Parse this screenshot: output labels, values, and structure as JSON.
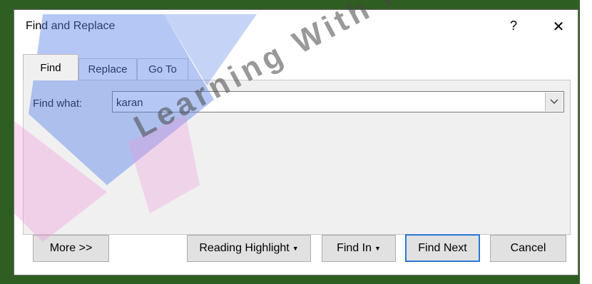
{
  "dialog": {
    "title": "Find and Replace",
    "help_label": "?",
    "close_label": "✕"
  },
  "tabs": [
    {
      "label": "Find",
      "active": true
    },
    {
      "label": "Replace",
      "active": false
    },
    {
      "label": "Go To",
      "active": false
    }
  ],
  "find": {
    "label": "Find what:",
    "value": "karan"
  },
  "buttons": {
    "more": "More >>",
    "reading_highlight": "Reading Highlight",
    "find_in": "Find In",
    "find_next": "Find Next",
    "cancel": "Cancel"
  },
  "watermark": {
    "text": "Learning With Innovation"
  },
  "colors": {
    "accent": "#2a78d4",
    "frame": "#2f5e22",
    "panel": "#f0f0f0"
  }
}
